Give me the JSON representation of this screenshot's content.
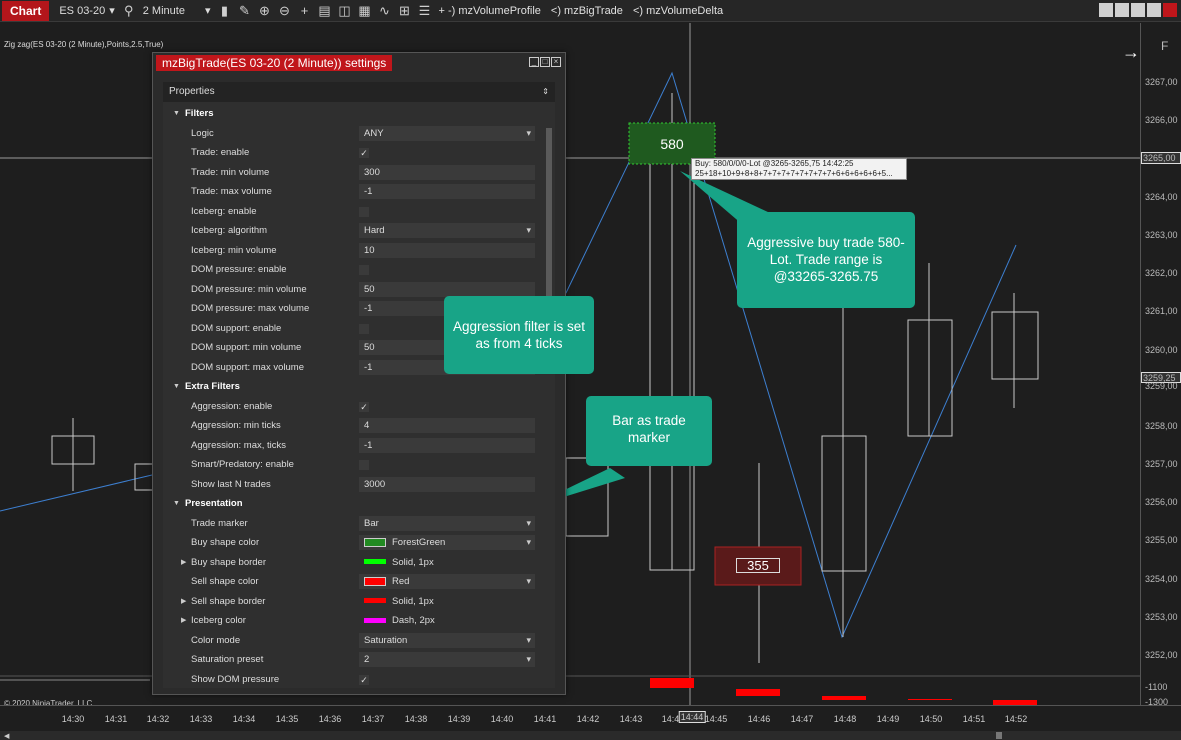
{
  "toolbar": {
    "chart_label": "Chart",
    "instrument": "ES 03-20",
    "interval": "2 Minute",
    "indicators": [
      "+ -) mzVolumeProfile",
      "<) mzBigTrade",
      "<) mzVolumeDelta"
    ]
  },
  "chart": {
    "indicator_label": "Zig zag(ES 03-20 (2 Minute),Points,2.5,True)",
    "copyright": "© 2020 NinjaTrader, LLC",
    "price_ticks": [
      "3267,00",
      "3266,00",
      "3265,00",
      "3264,00",
      "3263,00",
      "3262,00",
      "3261,00",
      "3260,00",
      "3259,25",
      "3259,00",
      "3258,00",
      "3257,00",
      "3256,00",
      "3255,00",
      "3254,00",
      "3253,00",
      "3252,00",
      "-1100",
      "-1300"
    ],
    "axis_corner": "F",
    "time_ticks": [
      "14:30",
      "14:31",
      "14:32",
      "14:33",
      "14:34",
      "14:35",
      "14:36",
      "14:37",
      "14:38",
      "14:39",
      "14:40",
      "14:41",
      "14:42",
      "14:43",
      "14:44",
      "14:44",
      "14:45",
      "14:46",
      "14:47",
      "14:48",
      "14:49",
      "14:50",
      "14:51",
      "14:52"
    ],
    "buy_trade_volume": "580",
    "sell_trade_volume": "355",
    "tooltip_line1": "Buy: 580/0/0/0-Lot @3265-3265,75  14:42:25",
    "tooltip_line2": "25+18+10+9+8+8+7+7+7+7+7+7+7+7+6+6+6+6+6+5..."
  },
  "dialog": {
    "title": "mzBigTrade(ES 03-20 (2 Minute)) settings",
    "header": "Properties",
    "rows": [
      {
        "type": "cat",
        "label": "Filters"
      },
      {
        "type": "select",
        "label": "Logic",
        "value": "ANY"
      },
      {
        "type": "check",
        "label": "Trade: enable",
        "value": "✓"
      },
      {
        "type": "text",
        "label": "Trade: min volume",
        "value": "300"
      },
      {
        "type": "text",
        "label": "Trade: max volume",
        "value": "-1"
      },
      {
        "type": "check",
        "label": "Iceberg: enable",
        "value": ""
      },
      {
        "type": "select",
        "label": "Iceberg: algorithm",
        "value": "Hard"
      },
      {
        "type": "text",
        "label": "Iceberg: min volume",
        "value": "10"
      },
      {
        "type": "check",
        "label": "DOM pressure: enable",
        "value": ""
      },
      {
        "type": "text",
        "label": "DOM pressure: min volume",
        "value": "50"
      },
      {
        "type": "text",
        "label": "DOM pressure: max volume",
        "value": "-1"
      },
      {
        "type": "check",
        "label": "DOM support: enable",
        "value": ""
      },
      {
        "type": "text",
        "label": "DOM support: min volume",
        "value": "50"
      },
      {
        "type": "text",
        "label": "DOM support: max volume",
        "value": "-1"
      },
      {
        "type": "cat",
        "label": "Extra Filters"
      },
      {
        "type": "check",
        "label": "Aggression: enable",
        "value": "✓"
      },
      {
        "type": "text",
        "label": "Aggression: min ticks",
        "value": "4"
      },
      {
        "type": "text",
        "label": "Aggression: max, ticks",
        "value": "-1"
      },
      {
        "type": "check",
        "label": "Smart/Predatory: enable",
        "value": ""
      },
      {
        "type": "text",
        "label": "Show last N trades",
        "value": "3000"
      },
      {
        "type": "cat",
        "label": "Presentation"
      },
      {
        "type": "select",
        "label": "Trade marker",
        "value": "Bar"
      },
      {
        "type": "color",
        "label": "Buy shape color",
        "value": "ForestGreen",
        "color": "#228b22"
      },
      {
        "type": "stroke",
        "label": "Buy shape border",
        "value": "Solid, 1px",
        "color": "#00ff00"
      },
      {
        "type": "color",
        "label": "Sell shape color",
        "value": "Red",
        "color": "#ff0000"
      },
      {
        "type": "stroke",
        "label": "Sell shape border",
        "value": "Solid, 1px",
        "color": "#ff0000"
      },
      {
        "type": "stroke",
        "label": "Iceberg color",
        "value": "Dash, 2px",
        "color": "#ff00ff"
      },
      {
        "type": "select",
        "label": "Color mode",
        "value": "Saturation"
      },
      {
        "type": "select",
        "label": "Saturation preset",
        "value": "2"
      },
      {
        "type": "check",
        "label": "Show DOM pressure",
        "value": "✓"
      }
    ]
  },
  "callouts": {
    "aggression": "Aggression filter is set as from 4 ticks",
    "bar": "Bar as trade marker",
    "buy": "Aggressive buy trade 580-Lot. Trade range is @33265-3265.75"
  }
}
